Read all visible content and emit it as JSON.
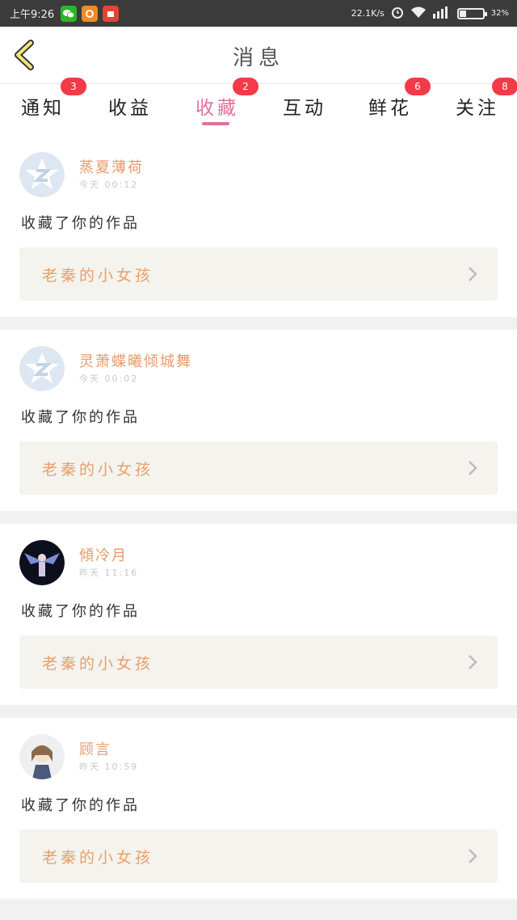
{
  "status_bar": {
    "time": "上午9:26",
    "speed": "22.1K/s",
    "battery_percent": "32%",
    "battery_level": 0.32
  },
  "header": {
    "title": "消息"
  },
  "tabs": [
    {
      "label": "通知",
      "badge": "3"
    },
    {
      "label": "收益",
      "badge": ""
    },
    {
      "label": "收藏",
      "badge": "2",
      "active": true
    },
    {
      "label": "互动",
      "badge": ""
    },
    {
      "label": "鲜花",
      "badge": "6"
    },
    {
      "label": "关注",
      "badge": "8"
    }
  ],
  "messages": [
    {
      "user": "蒸夏薄荷",
      "time": "今天 00:12",
      "action": "收藏了你的作品",
      "work": "老秦的小女孩",
      "avatar": "default-avatar-icon"
    },
    {
      "user": "灵萧蝶曦倾城舞",
      "time": "今天 00:02",
      "action": "收藏了你的作品",
      "work": "老秦的小女孩",
      "avatar": "default-avatar-icon"
    },
    {
      "user": "傾冷月",
      "time": "昨天 11:16",
      "action": "收藏了你的作品",
      "work": "老秦的小女孩",
      "avatar": "photo-avatar-dark"
    },
    {
      "user": "顾言",
      "time": "昨天 10:59",
      "action": "收藏了你的作品",
      "work": "老秦的小女孩",
      "avatar": "photo-avatar-light"
    }
  ],
  "colors": {
    "accent": "#e2709a",
    "badge": "#f33a48",
    "username": "#e89a6a",
    "work_title": "#e8a06a"
  }
}
